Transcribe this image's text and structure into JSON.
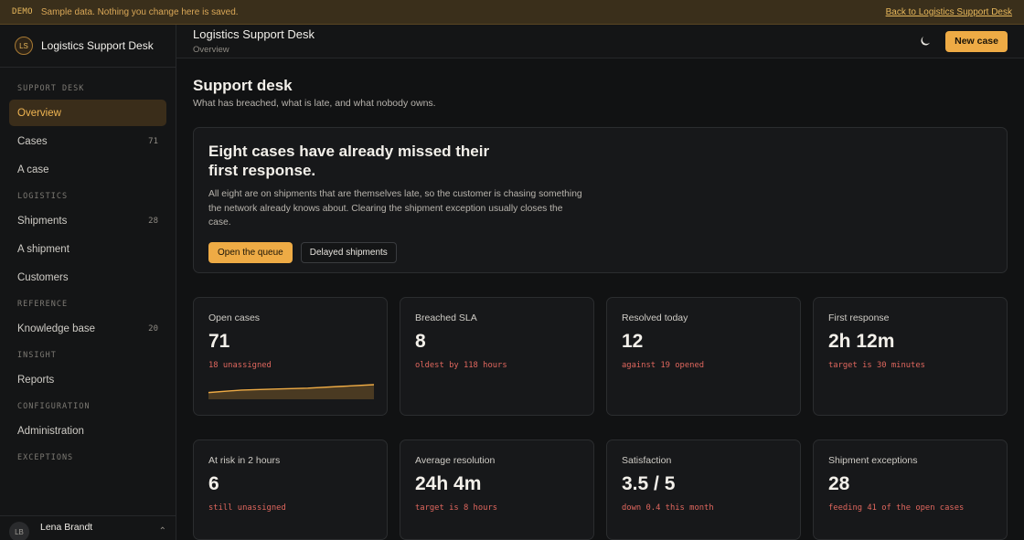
{
  "demo_bar": {
    "tag": "DEMO",
    "message": "Sample data. Nothing you change here is saved.",
    "link": "Back to Logistics Support Desk"
  },
  "brand": {
    "initials": "LS",
    "name": "Logistics Support Desk"
  },
  "sidebar": {
    "sections": [
      {
        "title": "SUPPORT DESK",
        "items": [
          {
            "label": "Overview",
            "count": "",
            "active": true
          },
          {
            "label": "Cases",
            "count": "71"
          },
          {
            "label": "A case",
            "count": ""
          }
        ]
      },
      {
        "title": "LOGISTICS",
        "items": [
          {
            "label": "Shipments",
            "count": "28"
          },
          {
            "label": "A shipment",
            "count": ""
          },
          {
            "label": "Customers",
            "count": ""
          }
        ]
      },
      {
        "title": "REFERENCE",
        "items": [
          {
            "label": "Knowledge base",
            "count": "20"
          }
        ]
      },
      {
        "title": "INSIGHT",
        "items": [
          {
            "label": "Reports",
            "count": ""
          }
        ]
      },
      {
        "title": "CONFIGURATION",
        "items": [
          {
            "label": "Administration",
            "count": ""
          }
        ]
      },
      {
        "title": "EXCEPTIONS",
        "items": []
      }
    ],
    "user": {
      "initials": "LB",
      "name": "Lena Brandt"
    }
  },
  "topbar": {
    "title": "Logistics Support Desk",
    "subtitle": "Overview",
    "new_case_label": "New case",
    "theme_icon": "moon-icon"
  },
  "page": {
    "title": "Support desk",
    "subtitle": "What has breached, what is late, and what nobody owns."
  },
  "hero": {
    "title": "Eight cases have already missed their first response.",
    "body": "All eight are on shipments that are themselves late, so the customer is chasing something the network already knows about. Clearing the shipment exception usually closes the case.",
    "primary_label": "Open the queue",
    "secondary_label": "Delayed shipments"
  },
  "metrics_row1": [
    {
      "label": "Open cases",
      "value": "71",
      "note": "18 unassigned",
      "sparkline": [
        2,
        3,
        3.4,
        3.8,
        4.5,
        5.2
      ]
    },
    {
      "label": "Breached SLA",
      "value": "8",
      "note": "oldest by 118 hours"
    },
    {
      "label": "Resolved today",
      "value": "12",
      "note": "against 19 opened"
    },
    {
      "label": "First response",
      "value": "2h 12m",
      "note": "target is 30 minutes"
    }
  ],
  "metrics_row2": [
    {
      "label": "At risk in 2 hours",
      "value": "6",
      "note": "still unassigned"
    },
    {
      "label": "Average resolution",
      "value": "24h 4m",
      "note": "target is 8 hours"
    },
    {
      "label": "Satisfaction",
      "value": "3.5 / 5",
      "note": "down 0.4 this month"
    },
    {
      "label": "Shipment exceptions",
      "value": "28",
      "note": "feeding 41 of the open cases"
    }
  ],
  "colors": {
    "accent": "#eeab45",
    "alert": "#e0675e",
    "background": "#111213"
  }
}
